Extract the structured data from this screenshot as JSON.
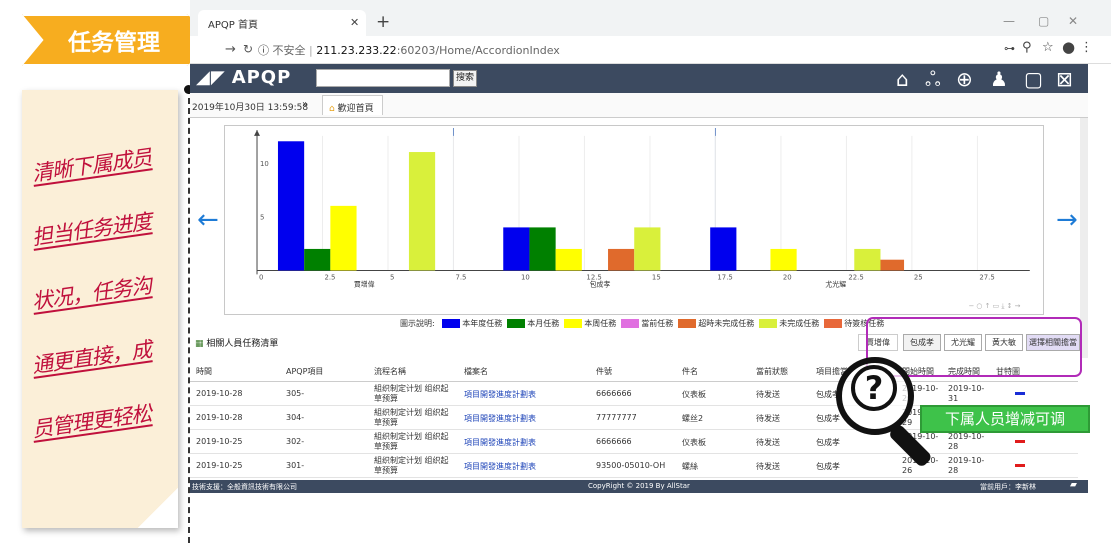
{
  "banner": {
    "title": "任务管理"
  },
  "note": {
    "lines": [
      "清晰下属成员",
      "担当任务进度",
      "状况，任务沟",
      "通更直接，成",
      "员管理更轻松"
    ]
  },
  "browser": {
    "tab_title": "APQP 首頁",
    "url_security": "不安全",
    "url_host": "211.23.233.22",
    "url_rest": ":60203/Home/AccordionIndex"
  },
  "app": {
    "logo": "APQP",
    "search_button": "搜索",
    "datetime": "2019年10月30日 13:59:58",
    "breadcrumb": "歡迎首頁",
    "colors": {
      "nav": "#3c4a60",
      "accent": "#1e7bd6"
    }
  },
  "chart_data": {
    "type": "bar",
    "title": "",
    "xlabel": "",
    "ylabel": "",
    "xlim": [
      0,
      29.5
    ],
    "ylim": [
      0,
      12.5
    ],
    "x_ticks": [
      0,
      2.5,
      5,
      7.5,
      10,
      12.5,
      15,
      17.5,
      20,
      22.5,
      25,
      27.5
    ],
    "y_ticks": [
      0,
      5,
      10
    ],
    "group_labels": [
      {
        "name": "賈增偉",
        "x": 4
      },
      {
        "name": "包成孝",
        "x": 13
      },
      {
        "name": "尤光耀",
        "x": 22
      }
    ],
    "series": [
      {
        "name": "本年度任務",
        "color": "#0000ee",
        "points": [
          [
            1.3,
            12
          ],
          [
            9.9,
            4
          ],
          [
            17.8,
            4
          ]
        ]
      },
      {
        "name": "本月任務",
        "color": "#008000",
        "points": [
          [
            2.3,
            2
          ],
          [
            10.9,
            4
          ]
        ]
      },
      {
        "name": "本周任務",
        "color": "#ffff00",
        "points": [
          [
            3.3,
            6
          ],
          [
            11.9,
            2
          ],
          [
            20.1,
            2
          ]
        ]
      },
      {
        "name": "當前任務",
        "color": "#e070e0",
        "points": []
      },
      {
        "name": "超時未完成任務",
        "color": "#e06a2c",
        "points": [
          [
            13.9,
            2
          ],
          [
            24.2,
            1
          ]
        ]
      },
      {
        "name": "未完成任務",
        "color": "#d9f03b",
        "points": [
          [
            6.3,
            11
          ],
          [
            14.9,
            4
          ],
          [
            23.3,
            2
          ]
        ]
      },
      {
        "name": "待簽核任務",
        "color": "#e8683a",
        "points": []
      }
    ],
    "legend_label": "圖示說明:",
    "toolbox": "− ○ ↑ ▭ ⤓ ↕ →"
  },
  "task_section": {
    "title": "相關人員任務清單",
    "buttons": [
      "賈增偉",
      "包成孝",
      "尤光耀",
      "黃大敏",
      "選擇相關擔當"
    ]
  },
  "table": {
    "headers": [
      "時間",
      "APQP項目",
      "流程名稱",
      "檔案名",
      "件號",
      "件名",
      "當前狀態",
      "項目擔當",
      "開始時間",
      "完成時間",
      "甘特圖"
    ],
    "rows": [
      [
        "2019-10-28",
        "305-",
        "組织制定计划 组织起草预算",
        "項目開發進度計劃表",
        "6666666",
        "仪表板",
        "待发送",
        "包成孝",
        "2019-10-29",
        "2019-10-31",
        ""
      ],
      [
        "2019-10-28",
        "304-",
        "組织制定计划 组织起草预算",
        "項目開發進度計劃表",
        "77777777",
        "螺丝2",
        "待发送",
        "包成孝",
        "2019-10-29",
        "2019-10-31",
        ""
      ],
      [
        "2019-10-25",
        "302-",
        "組织制定计划 组织起草预算",
        "項目開發進度計劃表",
        "6666666",
        "仪表板",
        "待发送",
        "包成孝",
        "2019-10-26",
        "2019-10-28",
        ""
      ],
      [
        "2019-10-25",
        "301-",
        "組织制定计划 组织起草预算",
        "項目開發進度計劃表",
        "93500-05010-OH",
        "螺絲",
        "待发送",
        "包成孝",
        "2019-10-26",
        "2019-10-28",
        ""
      ]
    ]
  },
  "footer": {
    "left": "技術支援：全般資訊技術有限公司",
    "center": "CopyRight © 2019 By AllStar",
    "right": "當前用戶：李新林"
  },
  "callout": {
    "text": "下属人员增减可调",
    "icon": "question-magnifier-icon"
  }
}
